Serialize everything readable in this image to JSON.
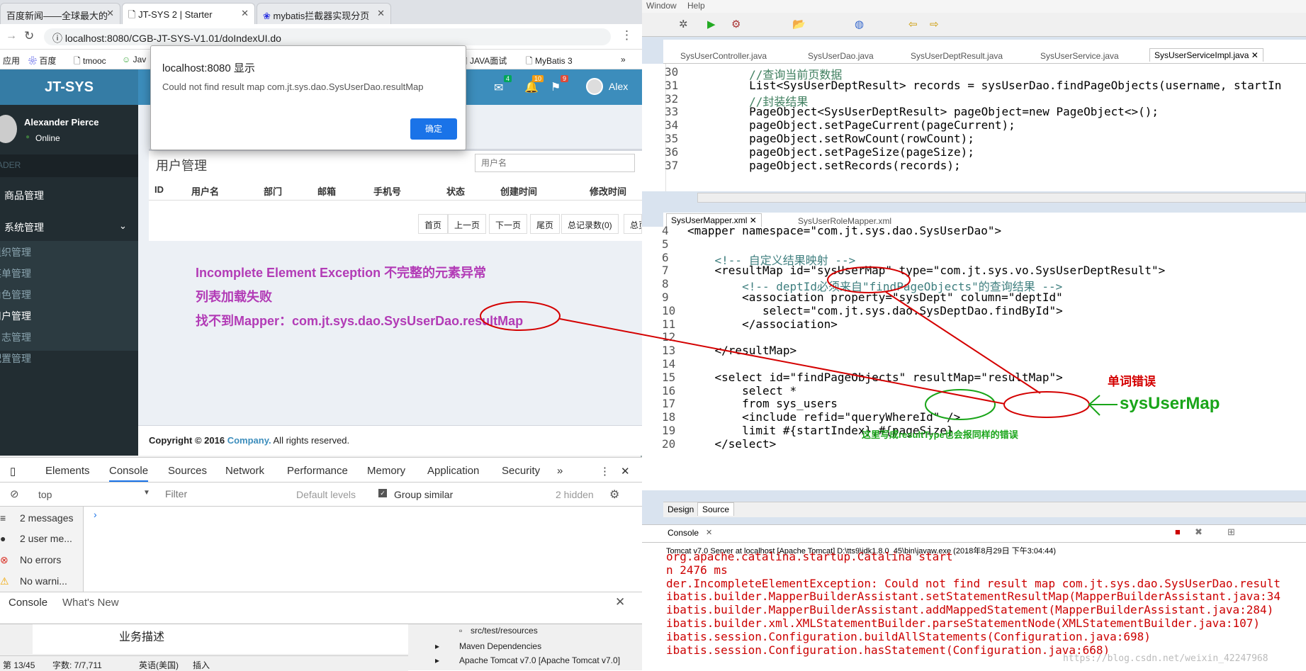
{
  "browser": {
    "tabs": [
      {
        "title": "百度新闻——全球最大的"
      },
      {
        "title": "JT-SYS 2 | Starter"
      },
      {
        "title": "mybatis拦截器实现分页"
      }
    ],
    "url": "localhost:8080/CGB-JT-SYS-V1.01/doIndexUI.do",
    "bookmarks": [
      "应用",
      "百度",
      "tmooc",
      "Jav",
      "JAVA面试",
      "MyBatis 3"
    ],
    "bookmarks_more": "»"
  },
  "app": {
    "brand": "JT-SYS",
    "nav_badges": [
      "4",
      "10",
      "9"
    ],
    "nav_user": "Alex",
    "user_name": "Alexander Pierce",
    "user_status": "Online",
    "sidebar_header": "ADER",
    "menu": [
      "商品管理",
      "系统管理"
    ],
    "submenu": [
      "组织管理",
      "菜单管理",
      "角色管理",
      "用户管理",
      "日志管理",
      "配置管理"
    ],
    "panel_title": "用户管理",
    "search_placeholder": "用户名",
    "columns": [
      "ID",
      "用户名",
      "部门",
      "邮箱",
      "手机号",
      "状态",
      "创建时间",
      "修改时间"
    ],
    "pager": [
      "首页",
      "上一页",
      "下一页",
      "尾页",
      "总记录数(0)",
      "总页"
    ],
    "notes": [
      "Incomplete Element Exception 不完整的元素异常",
      "列表加载失败",
      "找不到Mapper：com.jt.sys.dao.SysUserDao.resultMap"
    ],
    "footer_prefix": "Copyright © 2016 ",
    "footer_company": "Company.",
    "footer_suffix": " All rights reserved."
  },
  "dialog": {
    "title": "localhost:8080 显示",
    "message": "Could not find result map com.jt.sys.dao.SysUserDao.resultMap",
    "ok": "确定"
  },
  "devtools": {
    "tabs": [
      "Elements",
      "Console",
      "Sources",
      "Network",
      "Performance",
      "Memory",
      "Application",
      "Security"
    ],
    "context": "top",
    "filter_placeholder": "Filter",
    "levels": "Default levels",
    "group_similar": "Group similar",
    "hidden": "2 hidden",
    "side": [
      "2 messages",
      "2 user me...",
      "No errors",
      "No warni..."
    ],
    "drawer_tabs": [
      "Console",
      "What's New"
    ]
  },
  "behind": {
    "text": "业务描述",
    "status": [
      "第 13/45",
      "字数: 7/7,711",
      "英语(美国)",
      "插入"
    ],
    "tree": [
      "src/test/resources",
      "Maven Dependencies",
      "Apache Tomcat v7.0 [Apache Tomcat v7.0]"
    ]
  },
  "eclipse": {
    "menu": [
      "Window",
      "Help"
    ],
    "java_tabs": [
      "SysUserController.java",
      "SysUserDao.java",
      "SysUserDeptResult.java",
      "SysUserService.java",
      "SysUserServiceImpl.java"
    ],
    "java_lines": [
      {
        "n": "30",
        "t": "        //查询当前页数据"
      },
      {
        "n": "31",
        "t": "        List<SysUserDeptResult> records = sysUserDao.findPageObjects(username, startIn"
      },
      {
        "n": "32",
        "t": "        //封装结果"
      },
      {
        "n": "33",
        "t": "        PageObject<SysUserDeptResult> pageObject=new PageObject<>();"
      },
      {
        "n": "34",
        "t": "        pageObject.setPageCurrent(pageCurrent);"
      },
      {
        "n": "35",
        "t": "        pageObject.setRowCount(rowCount);"
      },
      {
        "n": "36",
        "t": "        pageObject.setPageSize(pageSize);"
      },
      {
        "n": "37",
        "t": "        pageObject.setRecords(records);"
      }
    ],
    "xml_tabs": [
      "SysUserMapper.xml",
      "SysUserRoleMapper.xml"
    ],
    "xml_lines": [
      {
        "n": "4",
        "t": "<mapper namespace=\"com.jt.sys.dao.SysUserDao\">"
      },
      {
        "n": "5",
        "t": ""
      },
      {
        "n": "6",
        "t": "    <!-- 自定义结果映射 -->"
      },
      {
        "n": "7",
        "t": "    <resultMap id=\"sysUserMap\" type=\"com.jt.sys.vo.SysUserDeptResult\">"
      },
      {
        "n": "8",
        "t": "        <!-- deptId必须来自\"findPageObjects\"的查询结果 -->"
      },
      {
        "n": "9",
        "t": "        <association property=\"sysDept\" column=\"deptId\""
      },
      {
        "n": "10",
        "t": "           select=\"com.jt.sys.dao.SysDeptDao.findById\">"
      },
      {
        "n": "11",
        "t": "        </association>"
      },
      {
        "n": "12",
        "t": ""
      },
      {
        "n": "13",
        "t": "    </resultMap>"
      },
      {
        "n": "14",
        "t": ""
      },
      {
        "n": "15",
        "t": "    <select id=\"findPageObjects\" resultMap=\"resultMap\">"
      },
      {
        "n": "16",
        "t": "        select *"
      },
      {
        "n": "17",
        "t": "        from sys_users"
      },
      {
        "n": "18",
        "t": "        <include refid=\"queryWhereId\" />"
      },
      {
        "n": "19",
        "t": "        limit #{startIndex},#{pageSize}"
      },
      {
        "n": "20",
        "t": "    </select>"
      }
    ],
    "design_tabs": [
      "Design",
      "Source"
    ],
    "annot_word_error": "单词错误",
    "annot_fix": "sysUserMap",
    "annot_type": "这里写成resultType也会报同样的错误",
    "console_title": "Console",
    "console_header": "Tomcat v7.0 Server at localhost [Apache Tomcat] D:\\tts9\\jdk1.8.0_45\\bin\\javaw.exe (2018年8月29日 下午3:04:44)",
    "console_lines": [
      "org.apache.catalina.startup.Catalina start",
      "n 2476 ms",
      "der.IncompleteElementException: Could not find result map com.jt.sys.dao.SysUserDao.result",
      "ibatis.builder.MapperBuilderAssistant.setStatementResultMap(MapperBuilderAssistant.java:34",
      "ibatis.builder.MapperBuilderAssistant.addMappedStatement(MapperBuilderAssistant.java:284)",
      "ibatis.builder.xml.XMLStatementBuilder.parseStatementNode(XMLStatementBuilder.java:107)",
      "ibatis.session.Configuration.buildAllStatements(Configuration.java:698)",
      "ibatis.session.Configuration.hasStatement(Configuration.java:668)"
    ],
    "watermark": "https://blog.csdn.net/weixin_42247968"
  },
  "colors": {
    "navbar": "#3c8dbc",
    "sidebar": "#222d32",
    "annotation_red": "#d40000",
    "annotation_green": "#19a519",
    "note_purple": "#b23bb6"
  }
}
